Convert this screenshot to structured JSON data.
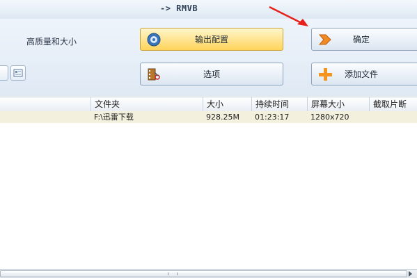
{
  "window": {
    "title": "-> RMVB"
  },
  "settings": {
    "quality_label": "高质量和大小",
    "output_config_label": "输出配置",
    "options_label": "选项",
    "ok_label": "确定",
    "add_file_label": "添加文件"
  },
  "table": {
    "columns": [
      "文件夹",
      "大小",
      "持续时间",
      "屏幕大小",
      "截取片断"
    ],
    "rows": [
      {
        "folder": "F:\\迅雷下载",
        "size": "928.25M",
        "duration": "01:23:17",
        "resolution": "1280x720",
        "clip": ""
      }
    ]
  },
  "colors": {
    "accent_arrow": "#e8201a",
    "highlight_row": "#f3f0dd",
    "output_button": "#ffd45a"
  },
  "icons": {
    "output": "gear-disc-icon",
    "options": "film-scissors-icon",
    "ok": "orange-arrow-icon",
    "add": "plus-icon"
  }
}
